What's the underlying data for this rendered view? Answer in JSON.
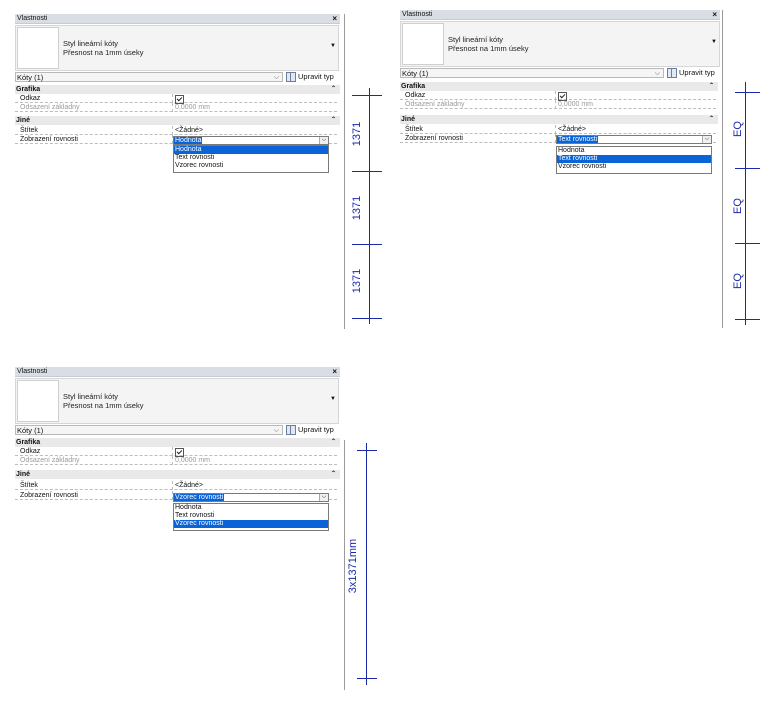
{
  "panel": {
    "title": "Vlastnosti",
    "close": "×",
    "type_name_line1": "Styl lineární kóty",
    "type_name_line2": "Přesnost na 1mm úseky",
    "selector": "Kóty (1)",
    "edit_type": "Upravit typ",
    "group_graphics": "Grafika",
    "group_other": "Jiné",
    "prop_leader": "Odkaz",
    "prop_baseline_offset": "Odsazení základny",
    "baseline_offset_value": "0,0000 mm",
    "prop_label": "Štítek",
    "label_value": "<Žádné>",
    "prop_equality_display": "Zobrazení rovnosti",
    "options": [
      "Hodnota",
      "Text rovnosti",
      "Vzorec rovnosti"
    ]
  },
  "panels": [
    {
      "selected": "Hodnota"
    },
    {
      "selected": "Text rovnosti"
    },
    {
      "selected": "Vzorec rovnosti"
    }
  ],
  "dims": {
    "value": "1371",
    "eq": "EQ",
    "formula": "3x1371mm"
  },
  "colors": {
    "dimension": "#1b2aa8",
    "selection": "#0a64d8"
  }
}
